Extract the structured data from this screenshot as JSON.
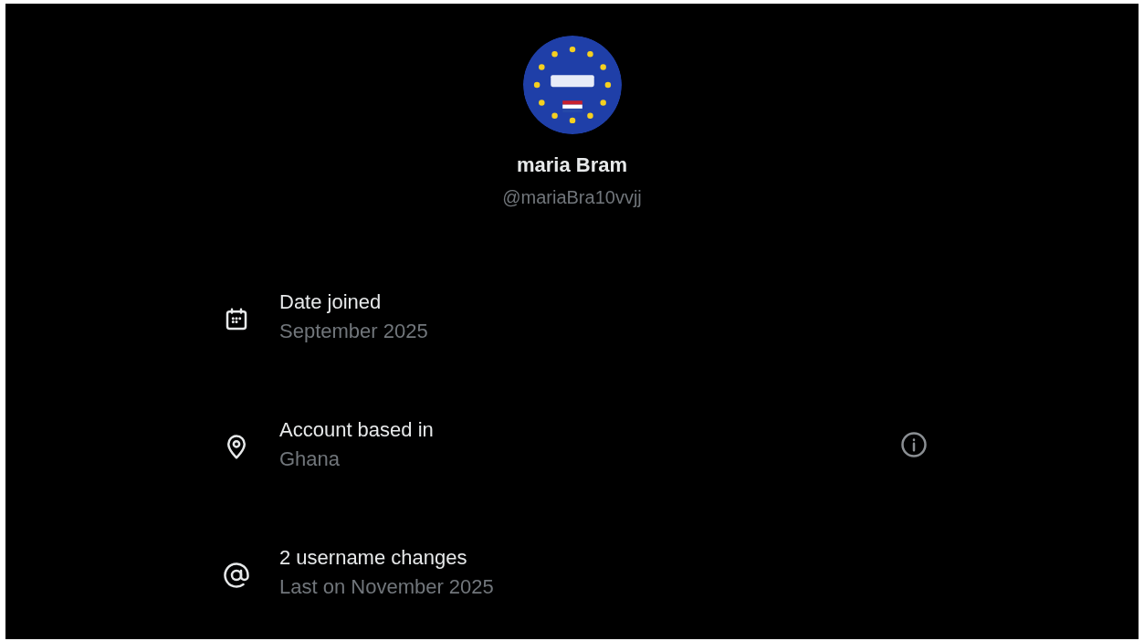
{
  "profile": {
    "name": "maria Bram",
    "handle": "@mariaBra10vvjj"
  },
  "rows": [
    {
      "kind": "calendar",
      "title": "Date joined",
      "value": "September 2025",
      "info": false
    },
    {
      "kind": "location",
      "title": "Account based in",
      "value": "Ghana",
      "info": true
    },
    {
      "kind": "at",
      "title": "2 username changes",
      "value": "Last on November 2025",
      "info": false
    }
  ]
}
